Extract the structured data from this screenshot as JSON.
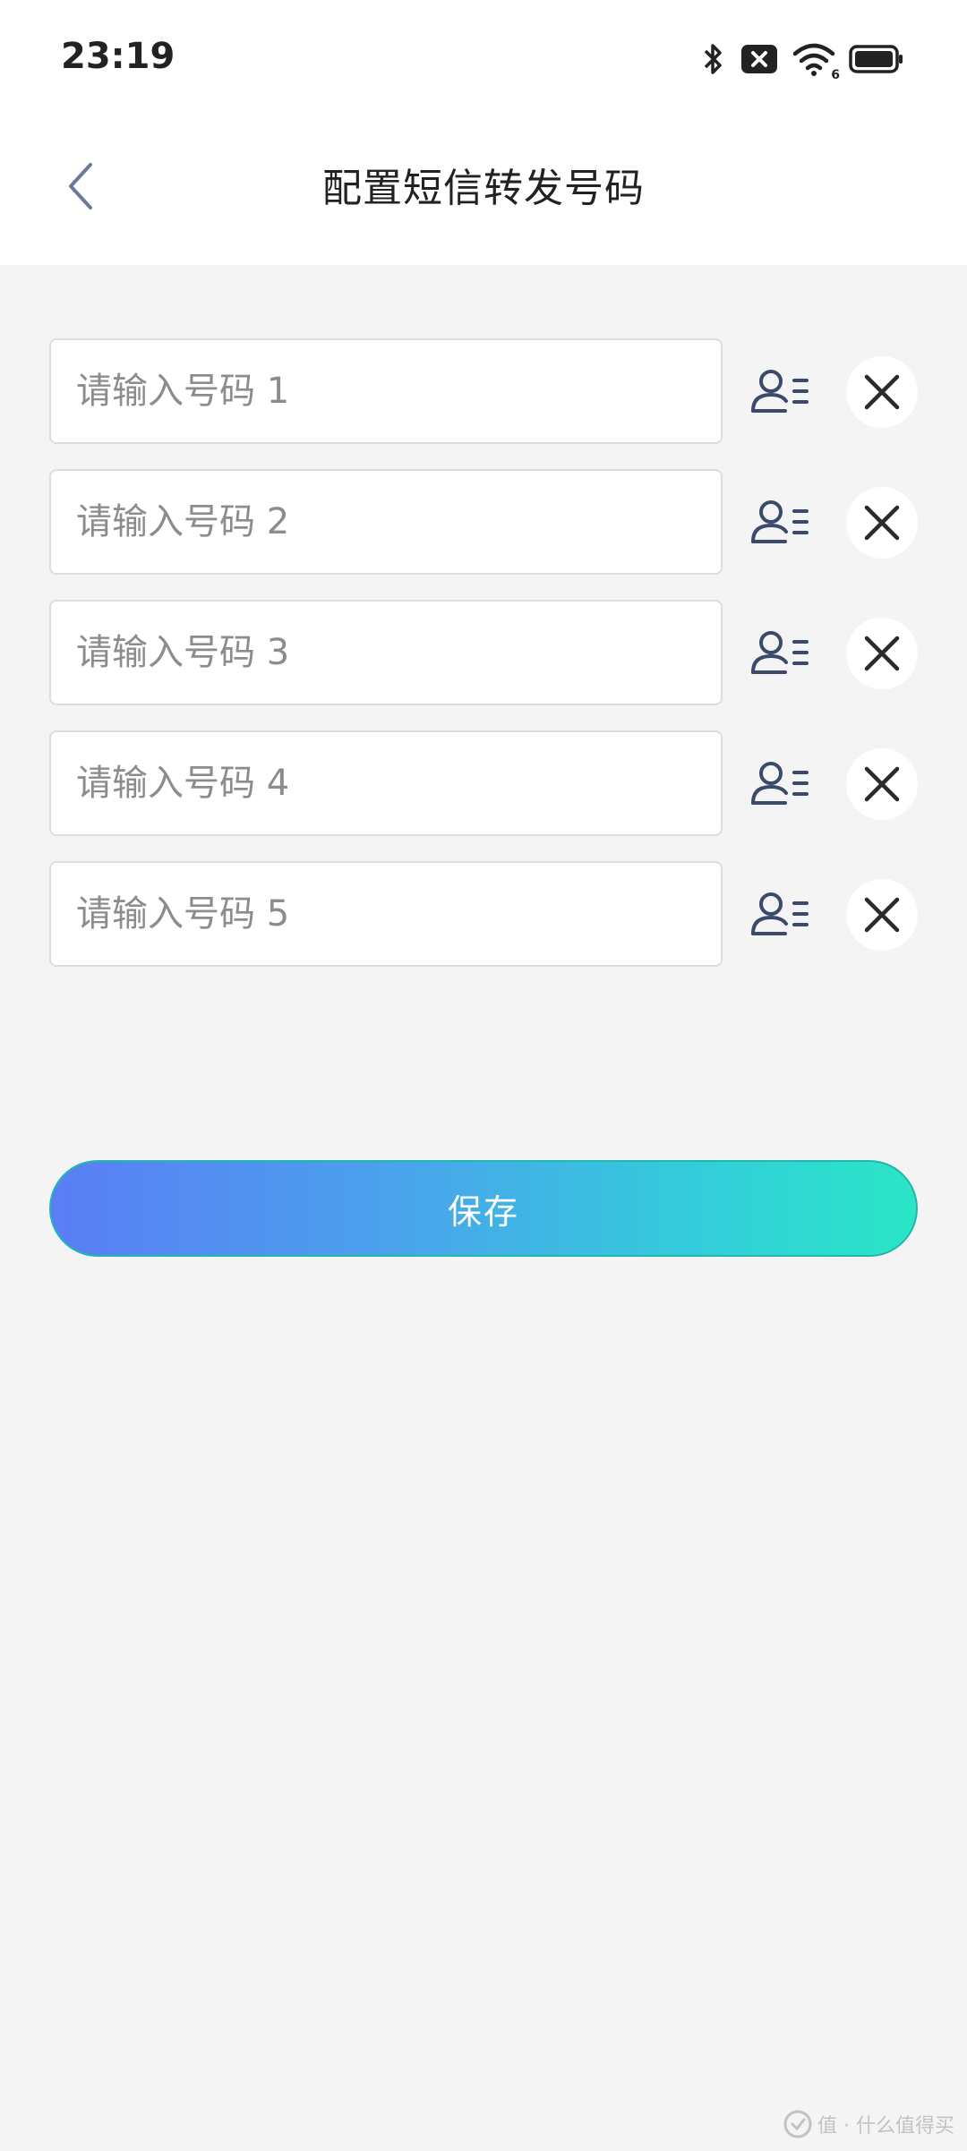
{
  "status_bar": {
    "time": "23:19",
    "wifi_tag": "6"
  },
  "header": {
    "title": "配置短信转发号码"
  },
  "inputs": [
    {
      "placeholder": "请输入号码 1",
      "value": ""
    },
    {
      "placeholder": "请输入号码 2",
      "value": ""
    },
    {
      "placeholder": "请输入号码 3",
      "value": ""
    },
    {
      "placeholder": "请输入号码 4",
      "value": ""
    },
    {
      "placeholder": "请输入号码 5",
      "value": ""
    }
  ],
  "icons": {
    "back": "chevron-left-icon",
    "contact": "contact-list-icon",
    "clear": "close-icon"
  },
  "save_button": {
    "label": "保存"
  },
  "watermark": {
    "text": "值 · 什么值得买"
  },
  "colors": {
    "background": "#f4f4f5",
    "header": "#ffffff",
    "gradient_start": "#5a7df5",
    "gradient_end": "#2ae6c6",
    "icon": "#3b4a6b"
  }
}
